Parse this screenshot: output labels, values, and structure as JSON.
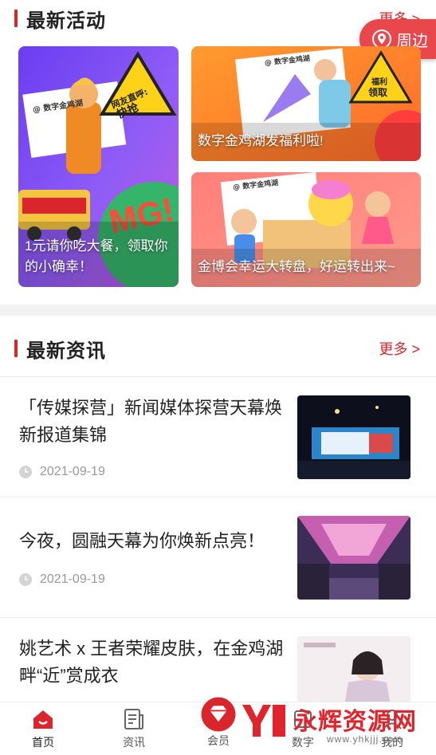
{
  "activities": {
    "title": "最新活动",
    "more": "更多 >",
    "nearby_label": "周边",
    "cards": [
      {
        "caption": "1元请你吃大餐，领取你的小确幸！",
        "sticker_top": "网友直呼:",
        "sticker_main": "快抢",
        "brand": "@ 数字金鸡湖",
        "badge": "MG!"
      },
      {
        "caption": "数字金鸡湖发福利啦!",
        "brand": "@ 数字金鸡湖",
        "sticker_top": "福利",
        "sticker_main": "领取"
      },
      {
        "caption": "金博会幸运大转盘，好运转出来~",
        "brand": "@ 数字金鸡湖"
      }
    ]
  },
  "news": {
    "title": "最新资讯",
    "more": "更多 >",
    "items": [
      {
        "headline": "「传媒探营」新闻媒体探营天幕焕新报道集锦",
        "date": "2021-09-19"
      },
      {
        "headline": "今夜，圆融天幕为你焕新点亮！",
        "date": "2021-09-19"
      },
      {
        "headline": "姚艺术 x 王者荣耀皮肤，在金鸡湖畔“近”赏成衣"
      }
    ]
  },
  "tabbar": {
    "tabs": [
      {
        "label": "首页",
        "icon": "home-icon"
      },
      {
        "label": "资讯",
        "icon": "news-doc-icon"
      },
      {
        "label": "会员",
        "icon": "member-gem-icon"
      },
      {
        "label": "数字",
        "icon": "digital-icon"
      },
      {
        "label": "我的",
        "icon": "profile-icon"
      }
    ]
  },
  "watermark": {
    "text": "永辉资源网",
    "url": "www.yhkjjj.com"
  },
  "colors": {
    "accent": "#d9262c",
    "pill": "#e8474b",
    "divider": "#f2f2f2"
  }
}
